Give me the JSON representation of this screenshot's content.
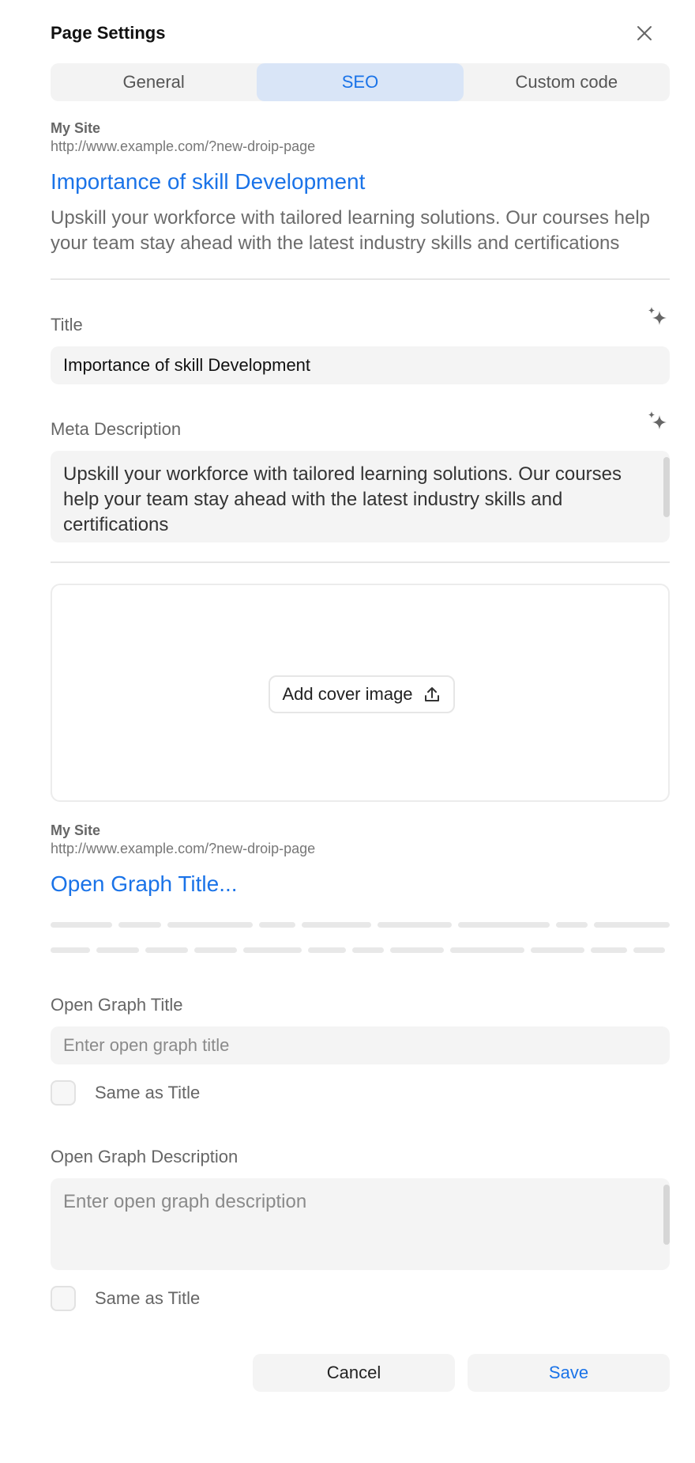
{
  "header": {
    "title": "Page Settings"
  },
  "tabs": [
    {
      "label": "General",
      "active": false
    },
    {
      "label": "SEO",
      "active": true
    },
    {
      "label": "Custom code",
      "active": false
    }
  ],
  "search_preview": {
    "site_name": "My Site",
    "url": "http://www.example.com/?new-droip-page",
    "title": "Importance of skill Development",
    "description": "Upskill your workforce with tailored learning solutions. Our courses help your team stay ahead with the latest industry skills and certifications"
  },
  "title_field": {
    "label": "Title",
    "value": "Importance of skill Development"
  },
  "meta_description_field": {
    "label": "Meta Description",
    "value": "Upskill your workforce with tailored learning solutions. Our courses help your team stay ahead with the latest industry skills and certifications"
  },
  "cover": {
    "button_label": "Add cover image"
  },
  "og_preview": {
    "site_name": "My Site",
    "url": "http://www.example.com/?new-droip-page",
    "title": "Open Graph Title..."
  },
  "og_title_field": {
    "label": "Open Graph Title",
    "placeholder": "Enter open graph title",
    "same_as_label": "Same as Title"
  },
  "og_description_field": {
    "label": "Open Graph Description",
    "placeholder": "Enter open graph description",
    "same_as_label": "Same as Title"
  },
  "footer": {
    "cancel_label": "Cancel",
    "save_label": "Save"
  },
  "colors": {
    "accent": "#1a73e8",
    "active_tab_bg": "#d9e5f7",
    "input_bg": "#f4f4f4"
  }
}
